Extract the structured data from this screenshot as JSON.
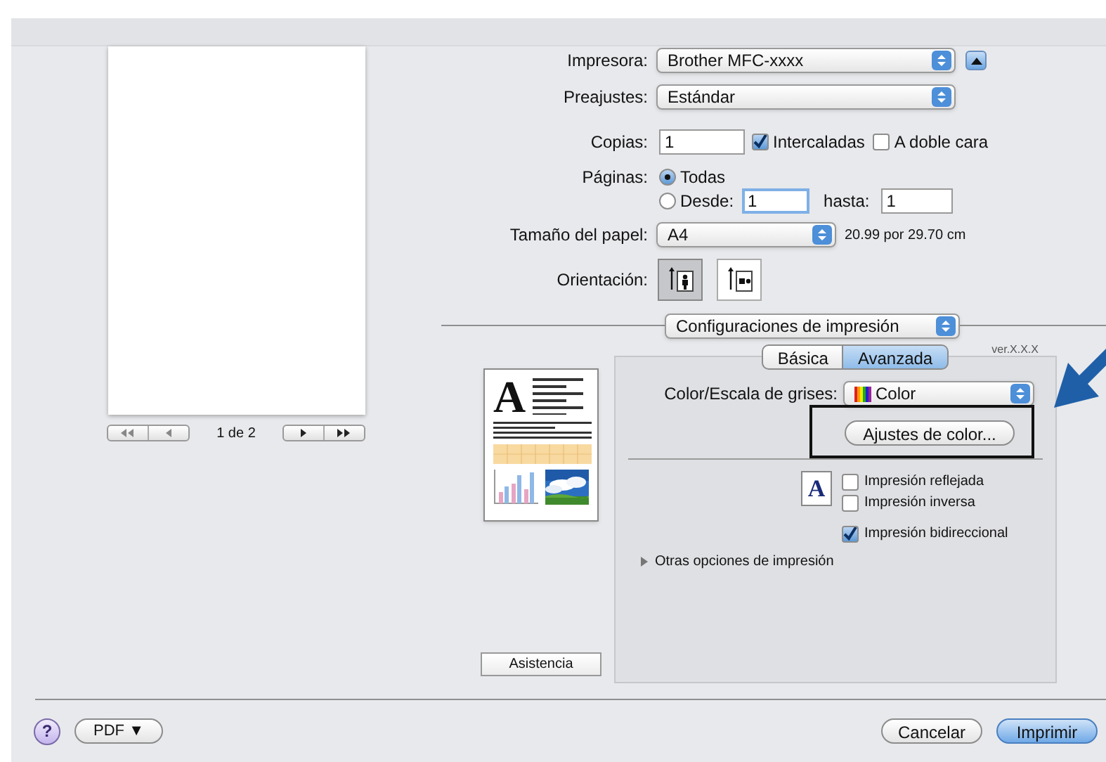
{
  "preview": {
    "page_indicator": "1 de 2"
  },
  "printer": {
    "label": "Impresora:",
    "value": "Brother MFC-xxxx"
  },
  "presets": {
    "label": "Preajustes:",
    "value": "Estándar"
  },
  "copies": {
    "label": "Copias:",
    "value": "1"
  },
  "collate": {
    "label": "Intercaladas",
    "checked": true
  },
  "two_sided": {
    "label": "A doble cara",
    "checked": false
  },
  "pages": {
    "label": "Páginas:",
    "options": [
      {
        "label": "Todas",
        "selected": true
      },
      {
        "label": "Desde:",
        "selected": false
      }
    ],
    "from": "1",
    "to_label": "hasta:",
    "to": "1"
  },
  "paper_size": {
    "label": "Tamaño del papel:",
    "value": "A4",
    "dimensions": "20.99 por 29.70 cm"
  },
  "orientation": {
    "label": "Orientación:",
    "options": [
      {
        "kind": "portrait",
        "selected": true
      },
      {
        "kind": "landscape",
        "selected": false
      }
    ]
  },
  "section": "Configuraciones de impresión",
  "tabs": [
    {
      "label": "Básica",
      "selected": false
    },
    {
      "label": "Avanzada",
      "selected": true
    }
  ],
  "version": "ver.X.X.X",
  "thumbnail": {
    "letter": "A"
  },
  "color_mode": {
    "label": "Color/Escala de grises:",
    "value": "Color"
  },
  "color_settings_button": "Ajustes de color...",
  "sample_letter": "A",
  "options": [
    {
      "label": "Impresión reflejada",
      "checked": false
    },
    {
      "label": "Impresión inversa",
      "checked": false
    },
    {
      "label": "Impresión bidireccional",
      "checked": true
    }
  ],
  "more_options": {
    "label": "Otras opciones de impresión",
    "expanded": false
  },
  "support_button": "Asistencia",
  "help_button": "?",
  "pdf_button": "PDF ▼",
  "buttons": [
    {
      "label": "Cancelar",
      "default": false
    },
    {
      "label": "Imprimir",
      "default": true
    }
  ]
}
